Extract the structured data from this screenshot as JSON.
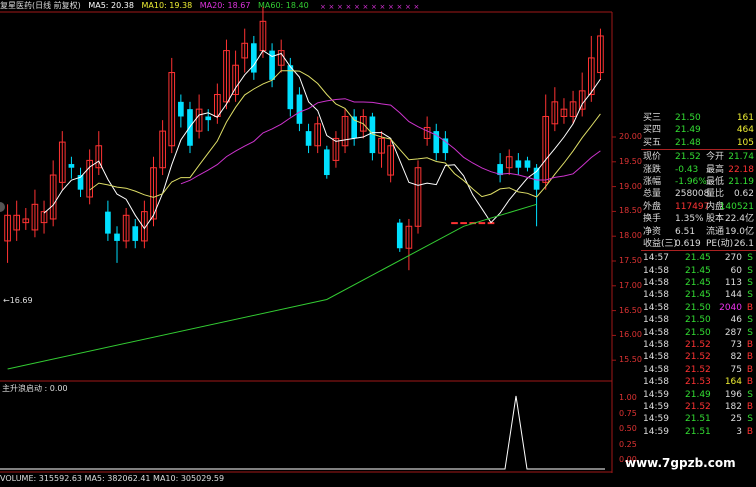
{
  "header": {
    "title": "复星医药(日线 前复权)",
    "ma5": "MA5: 20.38",
    "ma10": "MA10: 19.38",
    "ma20": "MA20: 18.67",
    "ma60": "MA60: 18.40"
  },
  "colors": {
    "up": "#ff3333",
    "down": "#00e0ff",
    "ma5": "#ffffff",
    "ma10": "#dddd66",
    "ma20": "#cc33cc",
    "ma60": "#33cc33"
  },
  "price_axis": [
    "20.00",
    "19.50",
    "19.00",
    "18.50",
    "18.00",
    "17.50",
    "17.00",
    "16.50",
    "16.00",
    "15.50"
  ],
  "indicator_axis": [
    "1.00",
    "0.75",
    "0.50",
    "0.25",
    "0.00"
  ],
  "low_marker": "←16.69",
  "indicator_label": "主升浪启动 : 0.00",
  "volume_label": "VOLUME: 315592.63  MA5: 382062.41  MA10: 305029.59",
  "quote": {
    "bids": [
      {
        "label": "买三",
        "price": "21.50",
        "vol": "161"
      },
      {
        "label": "买四",
        "price": "21.49",
        "vol": "464"
      },
      {
        "label": "买五",
        "price": "21.48",
        "vol": "105"
      }
    ],
    "stats": [
      {
        "l1": "现价",
        "v1": "21.52",
        "l2": "今开",
        "v2": "21.74",
        "c1": "g",
        "c2": "g"
      },
      {
        "l1": "涨跌",
        "v1": "-0.43",
        "l2": "最高",
        "v2": "22.18",
        "c1": "g",
        "c2": "r"
      },
      {
        "l1": "涨幅",
        "v1": "-1.96%",
        "l2": "最低",
        "v2": "21.19",
        "c1": "g",
        "c2": "g"
      },
      {
        "l1": "总量",
        "v1": "258008",
        "l2": "量比",
        "v2": "0.62",
        "c1": "w",
        "c2": "w"
      },
      {
        "l1": "外盘",
        "v1": "117497",
        "l2": "内盘",
        "v2": "140521",
        "c1": "r",
        "c2": "g"
      },
      {
        "l1": "换手",
        "v1": "1.35%",
        "l2": "股本",
        "v2": "22.4亿",
        "c1": "w",
        "c2": "w"
      },
      {
        "l1": "净资",
        "v1": "6.51",
        "l2": "流通",
        "v2": "19.0亿",
        "c1": "w",
        "c2": "w"
      },
      {
        "l1": "收益(三)",
        "v1": "0.619",
        "l2": "PE(动)",
        "v2": "26.1",
        "c1": "w",
        "c2": "w"
      }
    ],
    "trades": [
      {
        "time": "14:57",
        "price": "21.45",
        "vol": "270",
        "dir": "S",
        "pc": "g",
        "vc": "w"
      },
      {
        "time": "14:58",
        "price": "21.45",
        "vol": "60",
        "dir": "S",
        "pc": "g",
        "vc": "w"
      },
      {
        "time": "14:58",
        "price": "21.45",
        "vol": "113",
        "dir": "S",
        "pc": "g",
        "vc": "w"
      },
      {
        "time": "14:58",
        "price": "21.45",
        "vol": "144",
        "dir": "S",
        "pc": "g",
        "vc": "w"
      },
      {
        "time": "14:58",
        "price": "21.50",
        "vol": "2040",
        "dir": "B",
        "pc": "g",
        "vc": "m"
      },
      {
        "time": "14:58",
        "price": "21.50",
        "vol": "46",
        "dir": "S",
        "pc": "g",
        "vc": "w"
      },
      {
        "time": "14:58",
        "price": "21.50",
        "vol": "287",
        "dir": "S",
        "pc": "g",
        "vc": "w"
      },
      {
        "time": "14:58",
        "price": "21.52",
        "vol": "73",
        "dir": "B",
        "pc": "r",
        "vc": "w"
      },
      {
        "time": "14:58",
        "price": "21.52",
        "vol": "82",
        "dir": "B",
        "pc": "r",
        "vc": "w"
      },
      {
        "time": "14:58",
        "price": "21.52",
        "vol": "75",
        "dir": "B",
        "pc": "r",
        "vc": "w"
      },
      {
        "time": "14:58",
        "price": "21.53",
        "vol": "164",
        "dir": "B",
        "pc": "r",
        "vc": "y"
      },
      {
        "time": "14:59",
        "price": "21.49",
        "vol": "196",
        "dir": "S",
        "pc": "g",
        "vc": "w"
      },
      {
        "time": "14:59",
        "price": "21.52",
        "vol": "182",
        "dir": "B",
        "pc": "r",
        "vc": "w"
      },
      {
        "time": "14:59",
        "price": "21.51",
        "vol": "25",
        "dir": "S",
        "pc": "g",
        "vc": "w"
      },
      {
        "time": "14:59",
        "price": "21.51",
        "vol": "3",
        "dir": "B",
        "pc": "g",
        "vc": "w"
      }
    ]
  },
  "watermark": "www.7gpzb.com",
  "chart_data": {
    "type": "candlestick",
    "ylim": [
      15.3,
      20.3
    ],
    "candles": [
      {
        "o": 17.2,
        "c": 17.55,
        "h": 17.7,
        "l": 16.9
      },
      {
        "o": 17.35,
        "c": 17.55,
        "h": 17.75,
        "l": 17.2
      },
      {
        "o": 17.45,
        "c": 17.5,
        "h": 17.65,
        "l": 17.35
      },
      {
        "o": 17.35,
        "c": 17.7,
        "h": 17.9,
        "l": 17.25
      },
      {
        "o": 17.45,
        "c": 17.6,
        "h": 17.75,
        "l": 17.3
      },
      {
        "o": 17.5,
        "c": 18.1,
        "h": 18.3,
        "l": 17.4
      },
      {
        "o": 18.0,
        "c": 18.55,
        "h": 18.7,
        "l": 17.9
      },
      {
        "o": 18.25,
        "c": 18.2,
        "h": 18.35,
        "l": 18.05
      },
      {
        "o": 18.1,
        "c": 17.9,
        "h": 18.2,
        "l": 17.8
      },
      {
        "o": 17.8,
        "c": 18.3,
        "h": 18.45,
        "l": 17.7
      },
      {
        "o": 18.2,
        "c": 18.5,
        "h": 18.7,
        "l": 18.1
      },
      {
        "o": 17.6,
        "c": 17.3,
        "h": 17.75,
        "l": 17.2
      },
      {
        "o": 17.3,
        "c": 17.2,
        "h": 17.4,
        "l": 16.9
      },
      {
        "o": 17.2,
        "c": 17.55,
        "h": 17.65,
        "l": 17.1
      },
      {
        "o": 17.4,
        "c": 17.2,
        "h": 17.5,
        "l": 17.1
      },
      {
        "o": 17.2,
        "c": 17.6,
        "h": 17.75,
        "l": 17.1
      },
      {
        "o": 17.5,
        "c": 18.2,
        "h": 18.35,
        "l": 17.4
      },
      {
        "o": 18.2,
        "c": 18.7,
        "h": 18.85,
        "l": 18.1
      },
      {
        "o": 18.5,
        "c": 19.5,
        "h": 19.7,
        "l": 18.4
      },
      {
        "o": 19.1,
        "c": 18.9,
        "h": 19.2,
        "l": 18.75
      },
      {
        "o": 19.0,
        "c": 18.5,
        "h": 19.1,
        "l": 18.4
      },
      {
        "o": 18.7,
        "c": 19.0,
        "h": 19.2,
        "l": 18.6
      },
      {
        "o": 18.9,
        "c": 18.85,
        "h": 19.0,
        "l": 18.7
      },
      {
        "o": 18.9,
        "c": 19.2,
        "h": 19.35,
        "l": 18.8
      },
      {
        "o": 19.1,
        "c": 19.8,
        "h": 19.95,
        "l": 19.0
      },
      {
        "o": 19.2,
        "c": 19.6,
        "h": 19.8,
        "l": 19.1
      },
      {
        "o": 19.7,
        "c": 19.9,
        "h": 20.1,
        "l": 19.5
      },
      {
        "o": 19.9,
        "c": 19.5,
        "h": 20.0,
        "l": 19.4
      },
      {
        "o": 19.8,
        "c": 20.2,
        "h": 20.4,
        "l": 19.7
      },
      {
        "o": 19.8,
        "c": 19.4,
        "h": 19.9,
        "l": 19.3
      },
      {
        "o": 19.6,
        "c": 19.8,
        "h": 19.95,
        "l": 19.5
      },
      {
        "o": 19.6,
        "c": 19.0,
        "h": 19.7,
        "l": 18.9
      },
      {
        "o": 19.2,
        "c": 18.8,
        "h": 19.3,
        "l": 18.7
      },
      {
        "o": 18.7,
        "c": 18.5,
        "h": 18.8,
        "l": 18.4
      },
      {
        "o": 18.5,
        "c": 18.8,
        "h": 18.9,
        "l": 18.4
      },
      {
        "o": 18.45,
        "c": 18.1,
        "h": 18.5,
        "l": 18.05
      },
      {
        "o": 18.3,
        "c": 18.6,
        "h": 18.7,
        "l": 18.2
      },
      {
        "o": 18.5,
        "c": 18.9,
        "h": 19.0,
        "l": 18.4
      },
      {
        "o": 18.9,
        "c": 18.6,
        "h": 19.0,
        "l": 18.5
      },
      {
        "o": 18.7,
        "c": 18.9,
        "h": 19.0,
        "l": 18.6
      },
      {
        "o": 18.9,
        "c": 18.4,
        "h": 18.95,
        "l": 18.3
      },
      {
        "o": 18.4,
        "c": 18.6,
        "h": 18.7,
        "l": 18.2
      },
      {
        "o": 18.1,
        "c": 18.5,
        "h": 18.6,
        "l": 18.0
      },
      {
        "o": 17.45,
        "c": 17.1,
        "h": 17.5,
        "l": 17.05
      },
      {
        "o": 17.1,
        "c": 17.4,
        "h": 17.5,
        "l": 16.8
      },
      {
        "o": 17.4,
        "c": 18.2,
        "h": 18.3,
        "l": 17.3
      },
      {
        "o": 18.6,
        "c": 18.75,
        "h": 18.9,
        "l": 18.5
      },
      {
        "o": 18.7,
        "c": 18.4,
        "h": 18.8,
        "l": 18.3
      },
      {
        "o": 18.6,
        "c": 18.4,
        "h": 18.7,
        "l": 18.3
      },
      {
        "o": 17.45,
        "c": 17.45,
        "h": 17.45,
        "l": 17.45
      },
      {
        "o": 17.45,
        "c": 17.45,
        "h": 17.45,
        "l": 17.45
      },
      {
        "o": 17.45,
        "c": 17.45,
        "h": 17.45,
        "l": 17.45
      },
      {
        "o": 17.45,
        "c": 17.45,
        "h": 17.45,
        "l": 17.45
      },
      {
        "o": 17.45,
        "c": 17.45,
        "h": 17.45,
        "l": 17.45
      },
      {
        "o": 18.25,
        "c": 18.1,
        "h": 18.4,
        "l": 18.0
      },
      {
        "o": 18.2,
        "c": 18.35,
        "h": 18.45,
        "l": 18.1
      },
      {
        "o": 18.3,
        "c": 18.2,
        "h": 18.4,
        "l": 18.1
      },
      {
        "o": 18.3,
        "c": 18.2,
        "h": 18.35,
        "l": 18.15
      },
      {
        "o": 18.2,
        "c": 17.9,
        "h": 18.25,
        "l": 17.4
      },
      {
        "o": 18.0,
        "c": 18.9,
        "h": 19.2,
        "l": 17.9
      },
      {
        "o": 18.8,
        "c": 19.1,
        "h": 19.3,
        "l": 18.7
      },
      {
        "o": 18.9,
        "c": 19.0,
        "h": 19.15,
        "l": 18.8
      },
      {
        "o": 18.9,
        "c": 19.1,
        "h": 19.25,
        "l": 18.8
      },
      {
        "o": 19.0,
        "c": 19.25,
        "h": 19.5,
        "l": 18.9
      },
      {
        "o": 19.2,
        "c": 19.7,
        "h": 20.0,
        "l": 19.1
      },
      {
        "o": 19.5,
        "c": 20.0,
        "h": 20.1,
        "l": 19.4
      }
    ],
    "ma60": [
      [
        0,
        15.45
      ],
      [
        35,
        16.4
      ],
      [
        50,
        17.4
      ],
      [
        58,
        17.7
      ]
    ]
  }
}
